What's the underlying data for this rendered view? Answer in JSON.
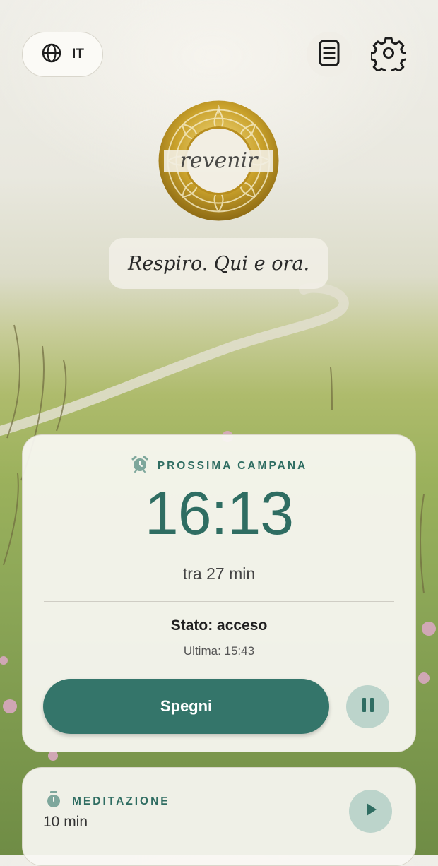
{
  "language": {
    "code": "IT",
    "icon": "globe-icon"
  },
  "header": {
    "notes_icon": "document-icon",
    "settings_icon": "gear-icon"
  },
  "logo": {
    "text": "revenir"
  },
  "tagline": "Respiro. Qui e ora.",
  "next_bell": {
    "eyebrow": "PROSSIMA CAMPANA",
    "icon": "alarm-clock-icon",
    "time": "16:13",
    "until": "tra 27 min",
    "status": "Stato: acceso",
    "last": "Ultima: 15:43",
    "primary_label": "Spegni",
    "pause_icon": "pause-icon"
  },
  "meditation": {
    "eyebrow": "MEDITAZIONE",
    "icon": "timer-icon",
    "value": "10 min",
    "play_icon": "play-icon"
  },
  "colors": {
    "accent": "#34756a",
    "accent_soft": "#bcd4cb",
    "gold": "#c9a12b"
  }
}
